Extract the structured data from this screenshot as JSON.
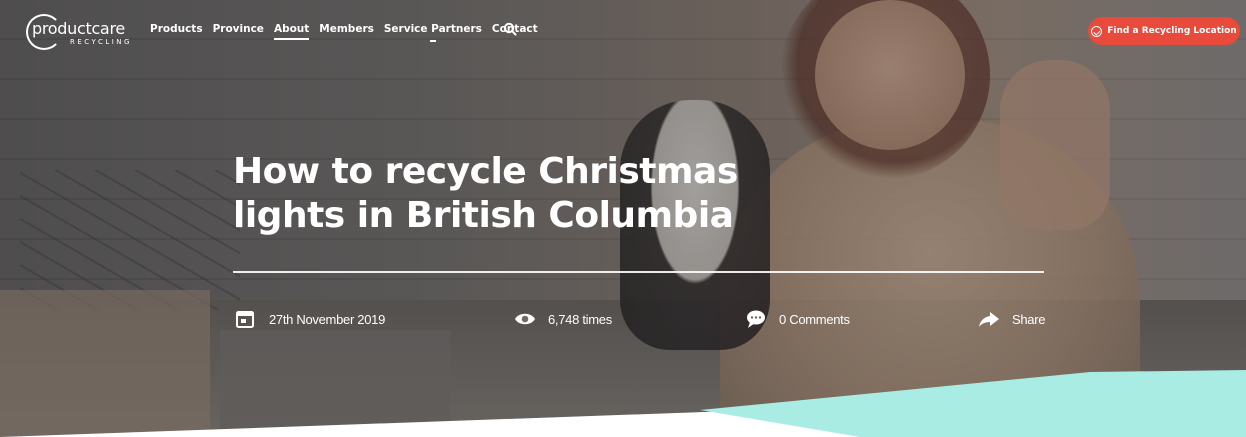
{
  "site": {
    "logo_main": "productcare",
    "logo_sub": "RECYCLING"
  },
  "nav": {
    "items": [
      {
        "label": "Products"
      },
      {
        "label": "Province"
      },
      {
        "label": "About"
      },
      {
        "label": "Members"
      },
      {
        "label": "Service Partners"
      },
      {
        "label": "Contact"
      }
    ],
    "active": "About",
    "search_icon": "search-icon",
    "cta_label": "Find a Recycling Location",
    "cta_color": "#e84a3c"
  },
  "article": {
    "title_line1": "How to recycle Christmas",
    "title_line2": "lights in British Columbia",
    "date": "27th November 2019",
    "views": "6,748 times",
    "comments": "0 Comments",
    "share": "Share"
  },
  "colors": {
    "accent_teal": "#a8ece3",
    "text": "#ffffff"
  }
}
